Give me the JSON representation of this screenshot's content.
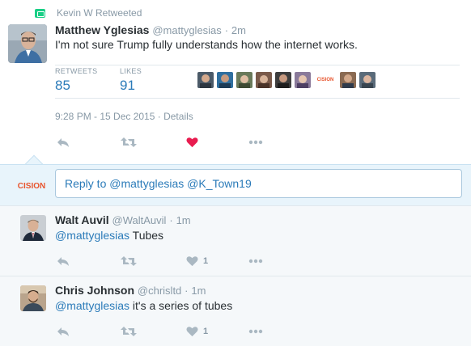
{
  "retweet_context": {
    "label": "Kevin W Retweeted"
  },
  "main_tweet": {
    "fullname": "Matthew Yglesias",
    "handle": "@mattyglesias",
    "separator": "·",
    "time": "2m",
    "text": "I'm not sure Trump fully understands how the internet works.",
    "stats": {
      "retweets_label": "RETWEETS",
      "retweets_value": "85",
      "likes_label": "LIKES",
      "likes_value": "91"
    },
    "likers": [
      {
        "name": "liker-1",
        "color": "#4b5a68"
      },
      {
        "name": "liker-2",
        "color": "#2f6f9f"
      },
      {
        "name": "liker-3",
        "color": "#5c7f3a"
      },
      {
        "name": "liker-4",
        "color": "#7a5a4a"
      },
      {
        "name": "liker-5",
        "color": "#3d3d3d"
      },
      {
        "name": "liker-6",
        "color": "#6b4f8a"
      },
      {
        "name": "cision",
        "text": "CISION"
      },
      {
        "name": "liker-8",
        "color": "#8a6a52"
      },
      {
        "name": "liker-9",
        "color": "#5a6b7a"
      }
    ],
    "timestamp": "9:28 PM - 15 Dec 2015",
    "details_separator": "·",
    "details_label": "Details",
    "liked": true
  },
  "reply_box": {
    "avatar_text": "CISION",
    "placeholder": "Reply to @mattyglesias @K_Town19"
  },
  "replies": [
    {
      "fullname": "Walt Auvil",
      "handle": "@WaltAuvil",
      "separator": "·",
      "time": "1m",
      "mention": "@mattyglesias",
      "text": " Tubes",
      "like_count": "1"
    },
    {
      "fullname": "Chris Johnson",
      "handle": "@chrisltd",
      "separator": "·",
      "time": "1m",
      "mention": "@mattyglesias",
      "text": " it's a series of tubes",
      "like_count": "1"
    }
  ],
  "colors": {
    "link": "#2b7bb9",
    "meta": "#8899a6",
    "like_active": "#e81c4f",
    "retweet_green": "#19cf86",
    "icon_grey": "#aab8c2"
  }
}
